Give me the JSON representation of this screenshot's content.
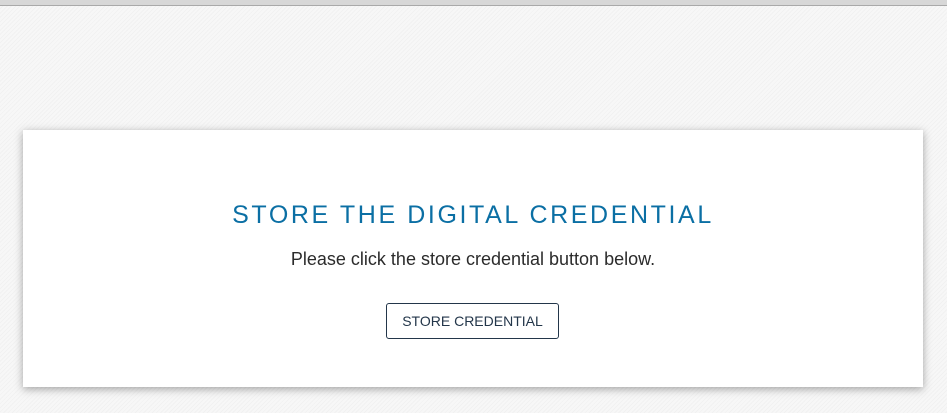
{
  "card": {
    "title": "STORE THE DIGITAL CREDENTIAL",
    "instruction": "Please click the store credential button below.",
    "button_label": "STORE CREDENTIAL"
  },
  "colors": {
    "title": "#0b6fa4",
    "button_border": "#23364a",
    "background": "#f7f7f7",
    "card_background": "#ffffff"
  }
}
